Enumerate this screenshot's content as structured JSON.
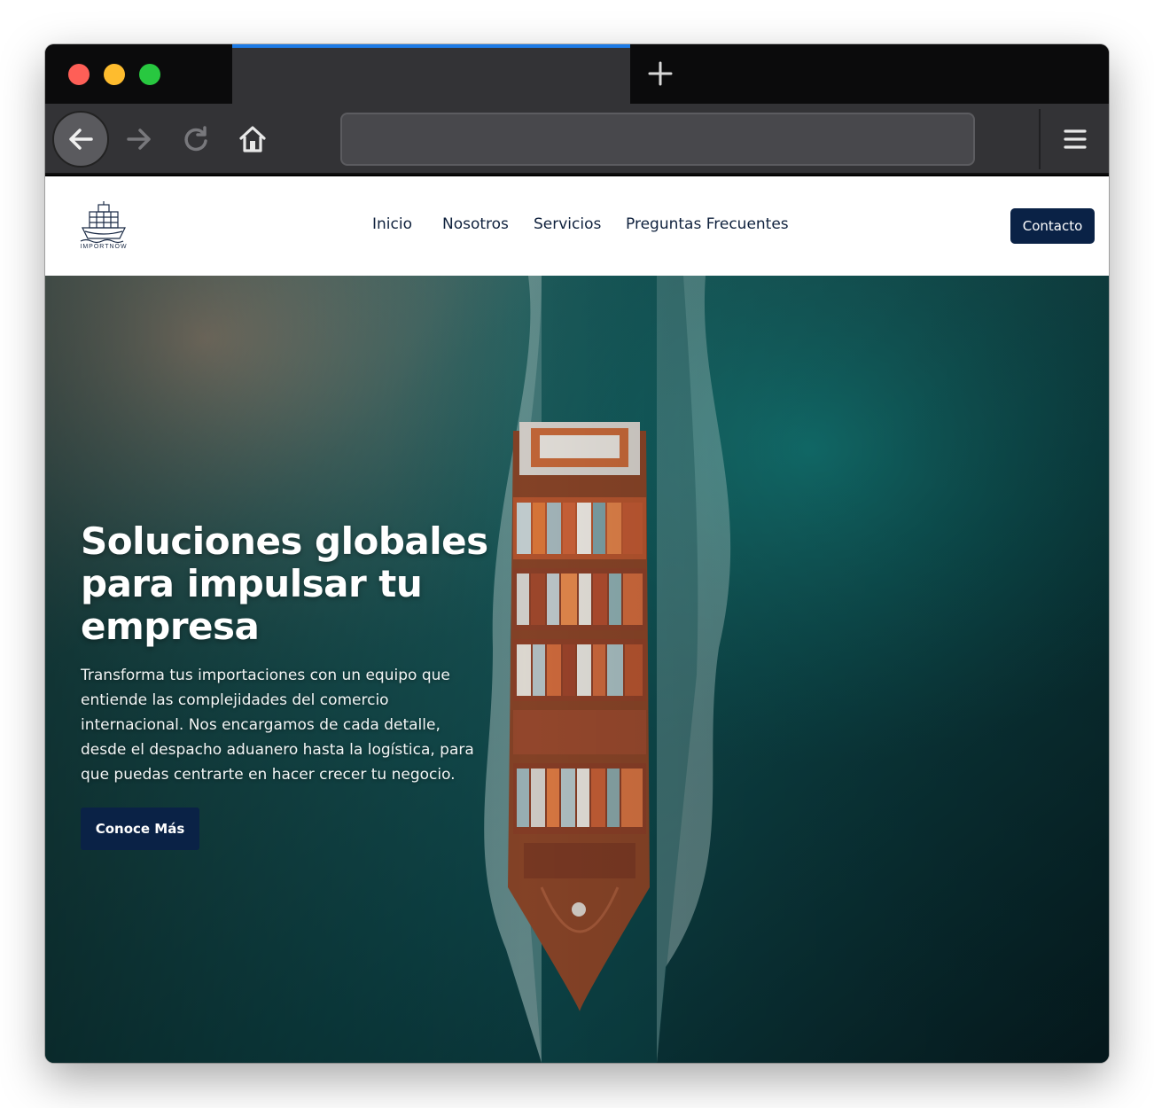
{
  "browser": {
    "tab_title": "",
    "url": "",
    "accent_color": "#1d7be6"
  },
  "site": {
    "logo_text": "IMPORTNOW",
    "nav": {
      "inicio": "Inicio",
      "nosotros": "Nosotros",
      "servicios": "Servicios",
      "faq": "Preguntas Frecuentes"
    },
    "contact_label": "Contacto",
    "brand_color": "#0a2246"
  },
  "hero": {
    "title": "Soluciones globales para impulsar tu empresa",
    "text": "Transforma tus importaciones con un equipo que entiende las complejidades del comercio internacional. Nos encargamos de cada detalle, desde el despacho aduanero hasta la logística, para que puedas centrarte en hacer crecer tu negocio.",
    "cta_label": "Conoce Más",
    "image": "aerial-container-ship-icon"
  },
  "icons": {
    "back": "arrow-left-icon",
    "forward": "arrow-right-icon",
    "reload": "reload-icon",
    "home": "home-icon",
    "menu": "hamburger-menu-icon",
    "new_tab": "plus-icon"
  }
}
